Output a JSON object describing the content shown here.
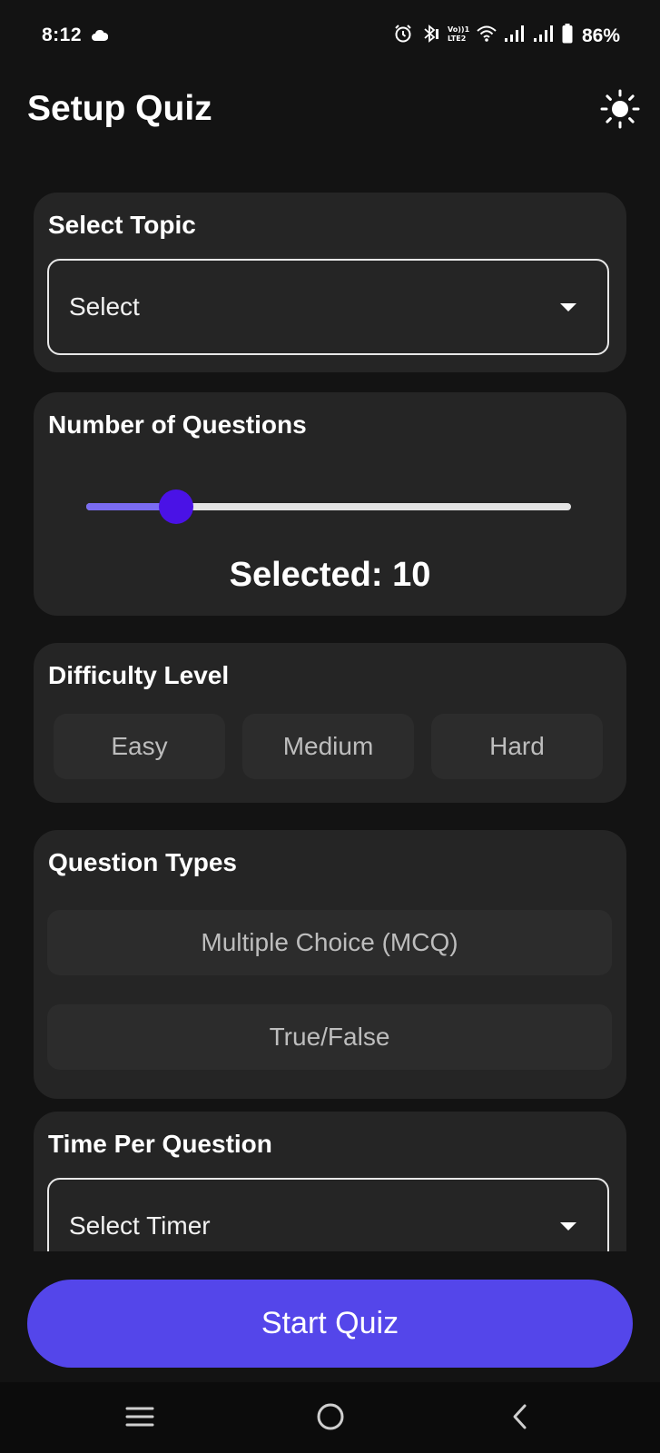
{
  "status_bar": {
    "time": "8:12",
    "battery": "86%",
    "icons": [
      "cloud-icon",
      "alarm-icon",
      "bluetooth-icon",
      "volte-icon",
      "wifi-icon",
      "signal-icon",
      "signal-icon",
      "battery-icon"
    ]
  },
  "header": {
    "title": "Setup Quiz",
    "theme_toggle_icon": "sun-icon"
  },
  "topic": {
    "title": "Select Topic",
    "value": "Select"
  },
  "questions": {
    "title": "Number of Questions",
    "slider_fraction": 0.185,
    "selected_text": "Selected: 10"
  },
  "difficulty": {
    "title": "Difficulty Level",
    "options": [
      "Easy",
      "Medium",
      "Hard"
    ]
  },
  "question_types": {
    "title": "Question Types",
    "options": [
      "Multiple Choice (MCQ)",
      "True/False"
    ]
  },
  "timer": {
    "title": "Time Per Question",
    "value": "Select Timer"
  },
  "actions": {
    "start_label": "Start Quiz"
  },
  "nav": {
    "icons": [
      "menu-icon",
      "home-icon",
      "back-icon"
    ]
  },
  "colors": {
    "background": "#131313",
    "card": "#252525",
    "accent": "#5446ea",
    "slider_thumb": "#4a12e6",
    "slider_fill": "#7a6cf2"
  }
}
